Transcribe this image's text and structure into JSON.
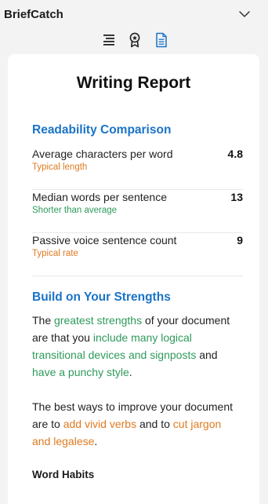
{
  "app": {
    "title": "BriefCatch"
  },
  "toolbar": {
    "icons": [
      "list-lines-icon",
      "award-ribbon-icon",
      "document-report-icon"
    ],
    "active_color": "#1a73c7"
  },
  "report": {
    "title": "Writing Report",
    "readability": {
      "heading": "Readability Comparison",
      "metrics": [
        {
          "label": "Average characters per word",
          "value": "4.8",
          "note": "Typical length",
          "note_color": "#e07a20"
        },
        {
          "label": "Median words per sentence",
          "value": "13",
          "note": "Shorter than average",
          "note_color": "#2e9a5c"
        },
        {
          "label": "Passive voice sentence count",
          "value": "9",
          "note": "Typical rate",
          "note_color": "#e07a20"
        }
      ]
    },
    "strengths": {
      "heading": "Build on Your Strengths",
      "p1_a": "The ",
      "p1_b": "greatest strengths",
      "p1_c": " of your document are that you ",
      "p1_d": "include many logical transitional devices and signposts",
      "p1_e": " and ",
      "p1_f": "have a punchy style",
      "p1_g": ".",
      "p2_a": "The best ways to improve your document are to ",
      "p2_b": "add vivid verbs",
      "p2_c": " and to ",
      "p2_d": "cut jargon and legalese",
      "p2_e": "."
    },
    "habits": {
      "heading": "Word Habits"
    }
  },
  "colors": {
    "accent_blue": "#1a73c7",
    "good_green": "#2e9a5c",
    "neutral_orange": "#e07a20"
  }
}
